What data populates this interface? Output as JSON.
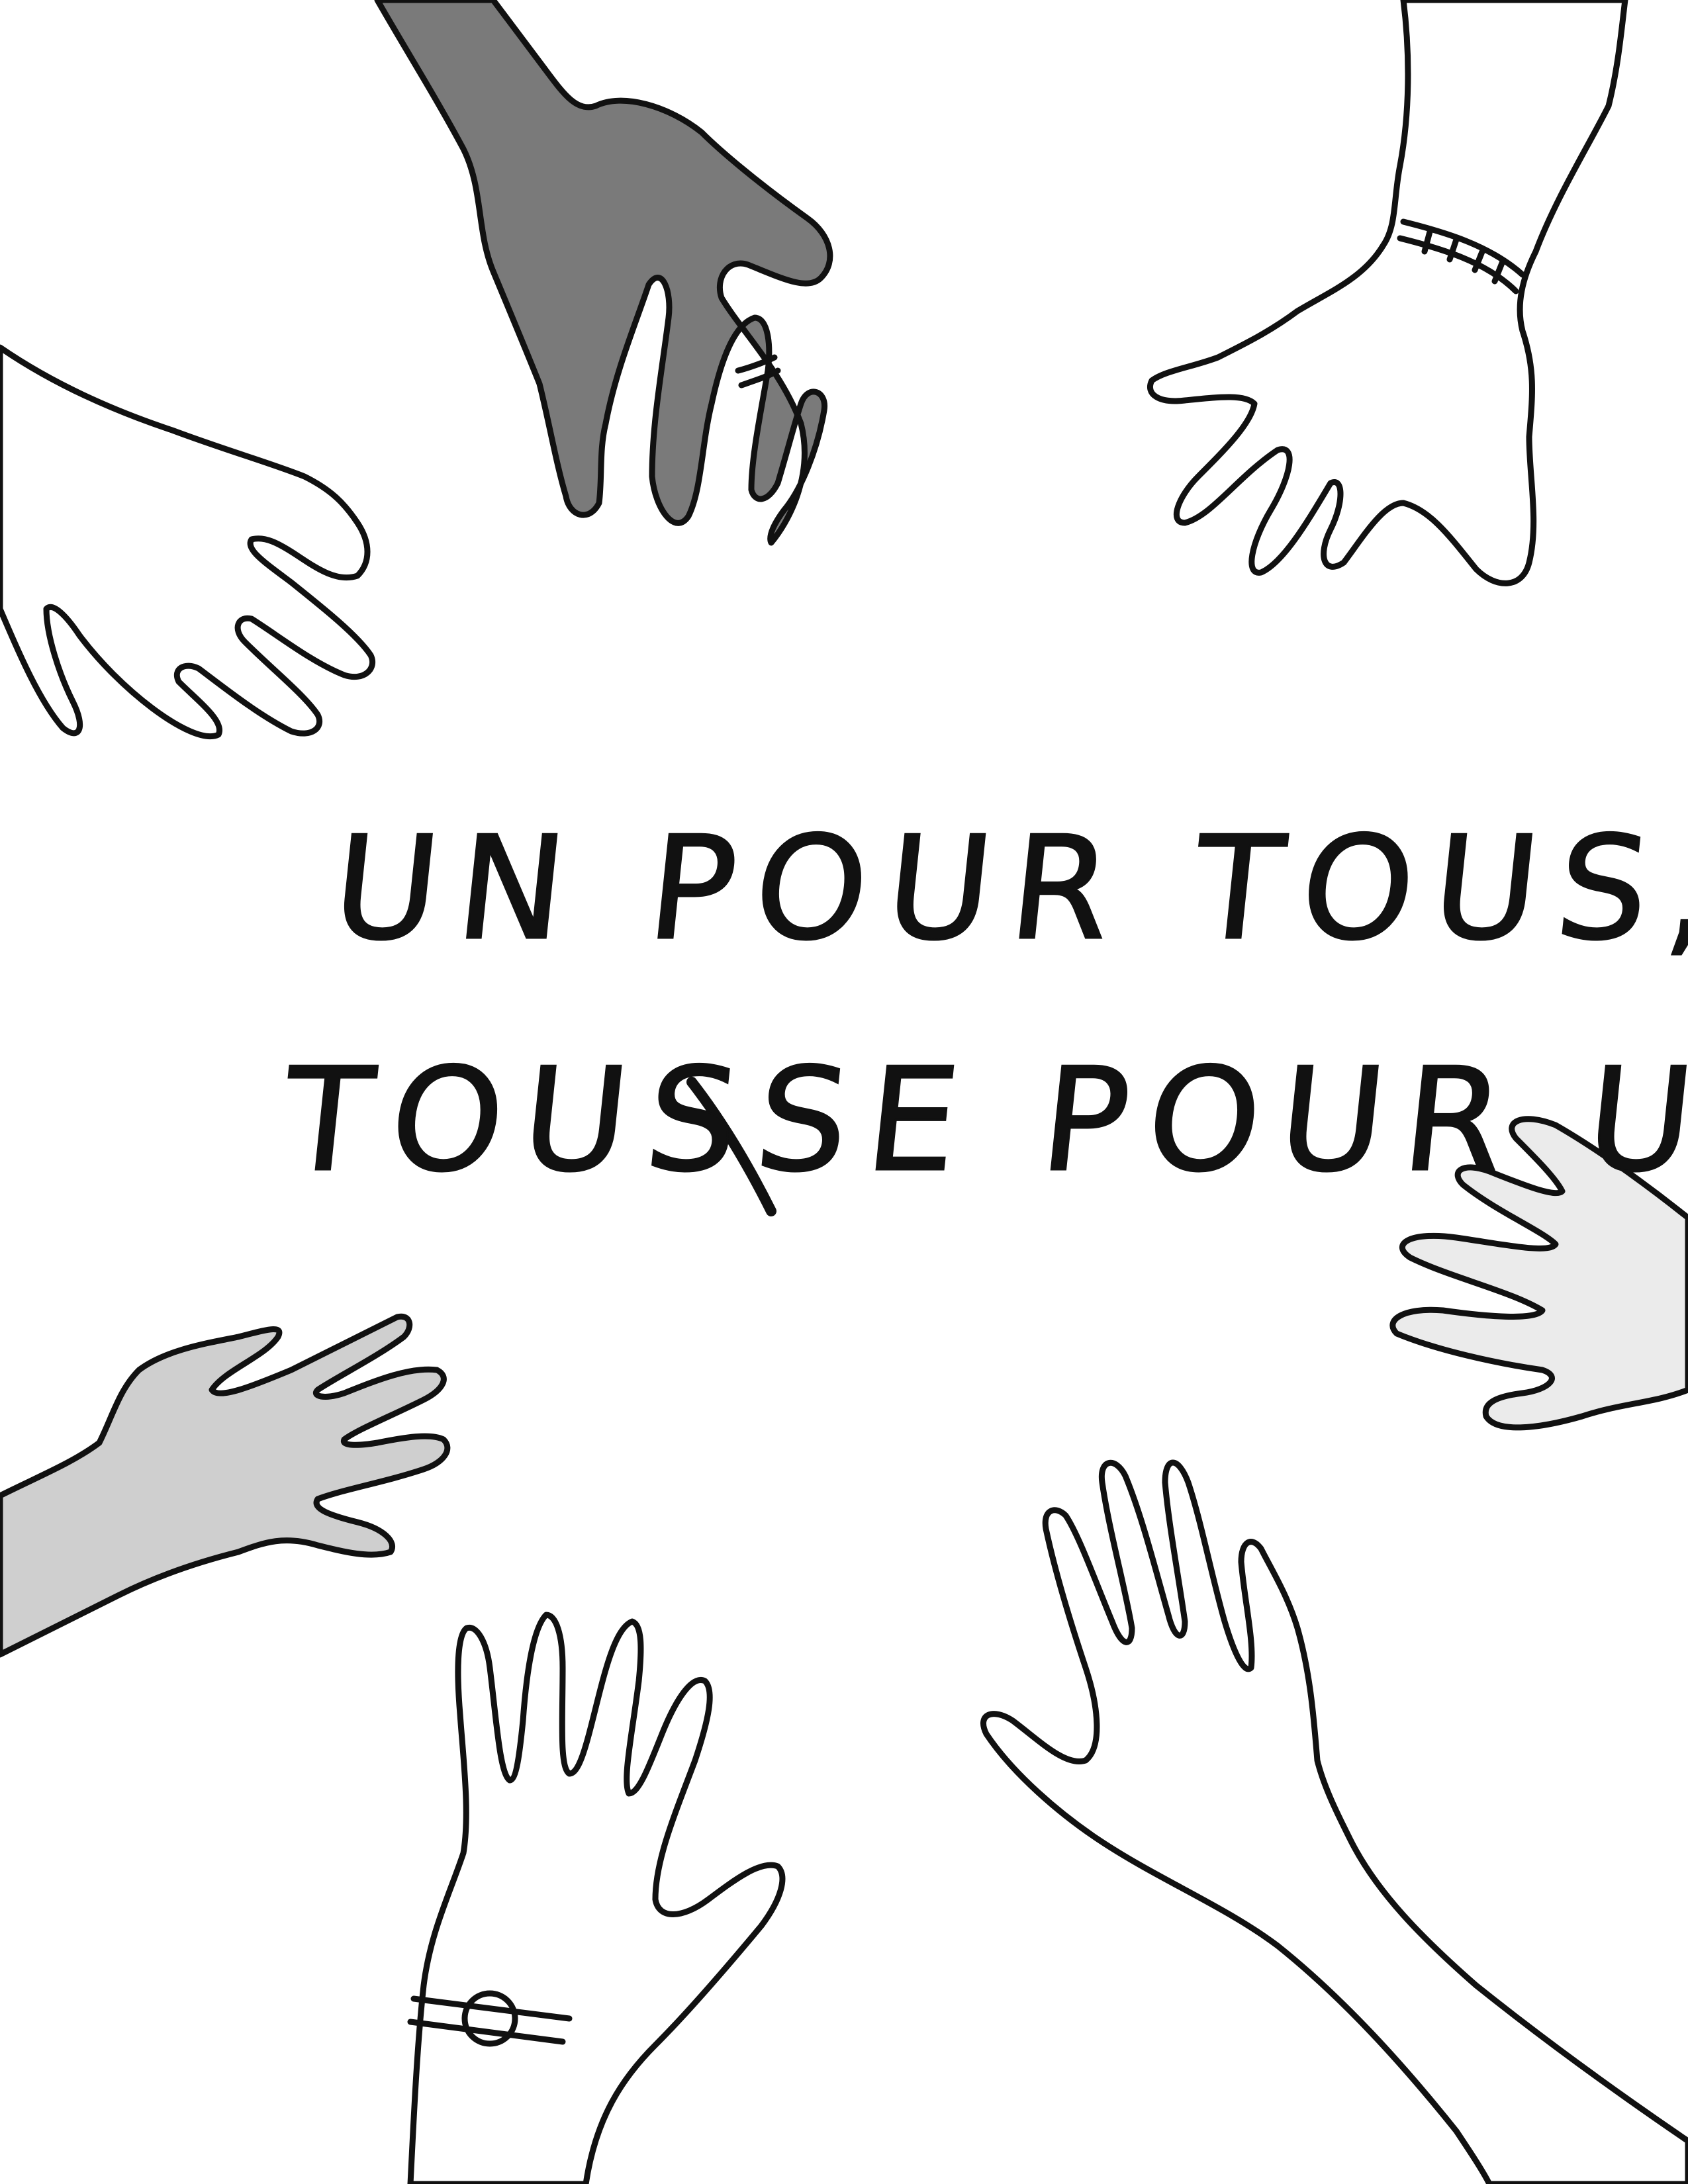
{
  "poster": {
    "slogan": {
      "line1": "UN POUR TOUS,",
      "line2_before": "TOUS",
      "line2_struck": "SE",
      "line2_after": " POUR UN"
    },
    "colors": {
      "background": "#ffffff",
      "ink": "#111111",
      "hand_dark_gray": "#7a7a7a",
      "hand_medium_gray": "#cfcfcf",
      "hand_light_gray": "#ebebeb",
      "hand_white": "#ffffff"
    },
    "hands": [
      {
        "name": "hand-dark-gray",
        "fill": "dark gray",
        "accessory": "ring"
      },
      {
        "name": "hand-top-right",
        "fill": "white",
        "accessory": "bracelet"
      },
      {
        "name": "hand-left-upper",
        "fill": "white",
        "accessory": "none"
      },
      {
        "name": "hand-right-middle",
        "fill": "light gray",
        "accessory": "none"
      },
      {
        "name": "hand-left-lower",
        "fill": "medium gray",
        "accessory": "none"
      },
      {
        "name": "hand-bottom-center",
        "fill": "white",
        "accessory": "watch"
      },
      {
        "name": "hand-bottom-right",
        "fill": "white",
        "accessory": "none"
      }
    ]
  }
}
